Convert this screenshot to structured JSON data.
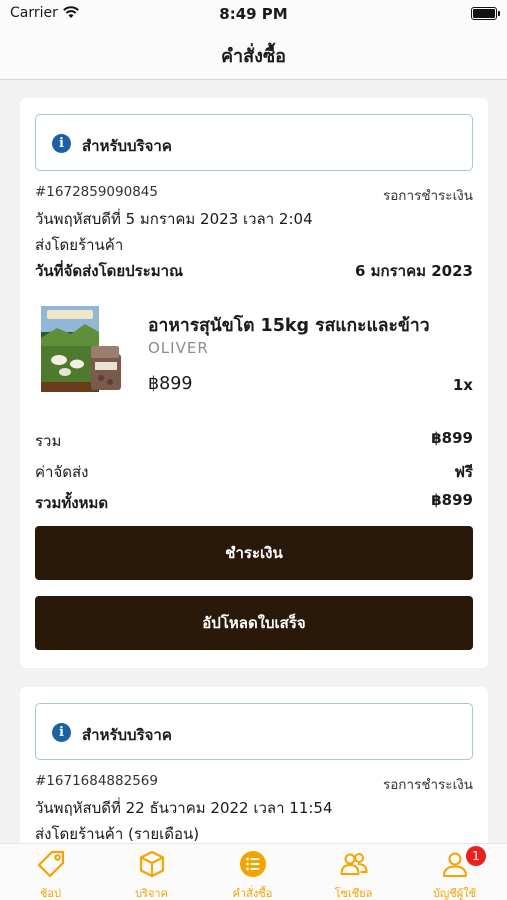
{
  "status_bar": {
    "carrier": "Carrier",
    "time": "8:49 PM"
  },
  "nav": {
    "title": "คำสั่งซื้อ"
  },
  "orders": [
    {
      "donation_note": "สำหรับบริจาค",
      "order_number": "#1672859090845",
      "status": "รอการชำระเงิน",
      "date": "วันพฤหัสบดีที่ 5 มกราคม 2023 เวลา 2:04",
      "ship_by": "ส่งโดยร้านค้า",
      "est_delivery_label": "วันที่จัดส่งโดยประมาณ",
      "est_delivery_date": "6 มกราคม 2023",
      "item": {
        "name": "อาหารสุนัขโต 15kg รสแกะและข้าว",
        "brand": "OLIVER",
        "price": "฿899",
        "quantity": "1x"
      },
      "summary": {
        "subtotal_label": "รวม",
        "subtotal": "฿899",
        "shipping_label": "ค่าจัดส่ง",
        "shipping": "ฟรี",
        "total_label": "รวมทั้งหมด",
        "total": "฿899"
      },
      "pay_button": "ชำระเงิน",
      "upload_button": "อัปโหลดใบเสร็จ"
    },
    {
      "donation_note": "สำหรับบริจาค",
      "order_number": "#1671684882569",
      "status": "รอการชำระเงิน",
      "date": "วันพฤหัสบดีที่ 22 ธันวาคม 2022 เวลา 11:54",
      "ship_by": "ส่งโดยร้านค้า (รายเดือน)"
    }
  ],
  "tabs": [
    {
      "label": "ช้อป",
      "icon": "tag-icon"
    },
    {
      "label": "บริจาค",
      "icon": "box-icon"
    },
    {
      "label": "คำสั่งซื้อ",
      "icon": "list-icon",
      "active": true
    },
    {
      "label": "โซเชียล",
      "icon": "people-icon"
    },
    {
      "label": "บัญชีผู้ใช้",
      "icon": "user-icon",
      "badge": "1"
    }
  ],
  "colors": {
    "accent": "#f5a300",
    "button": "#2a1809",
    "info": "#1a62a3",
    "badge": "#e8231e"
  }
}
